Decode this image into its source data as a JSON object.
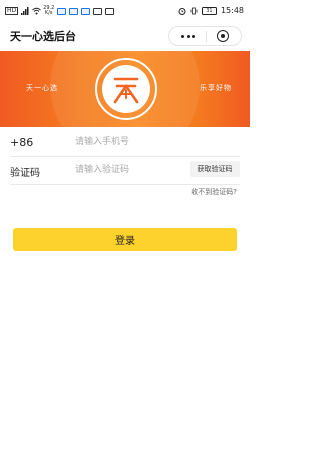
{
  "status_bar": {
    "network_label": "HD",
    "speed_value": "29.2",
    "speed_unit": "K/s",
    "battery": "31",
    "time": "15:48"
  },
  "header": {
    "title": "天一心选后台"
  },
  "banner": {
    "left_text": "天一心选",
    "right_text": "乐享好物",
    "logo_char": "天"
  },
  "form": {
    "country_code": "+86",
    "phone_placeholder": "请输入手机号",
    "code_label": "验证码",
    "code_placeholder": "请输入验证码",
    "get_code_label": "获取验证码",
    "no_code_link": "收不到验证码?"
  },
  "login_label": "登录",
  "colors": {
    "banner_orange": "#f47b20",
    "login_yellow": "#fdd22c"
  }
}
